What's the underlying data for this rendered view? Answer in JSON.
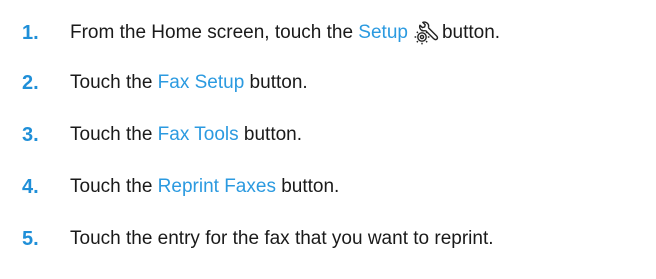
{
  "steps": [
    {
      "number": "1.",
      "before": "From the Home screen, touch the ",
      "highlight": "Setup",
      "icon": "setup-wrench-gear-icon",
      "after": "button."
    },
    {
      "number": "2.",
      "before": "Touch the ",
      "highlight": "Fax Setup",
      "after": " button."
    },
    {
      "number": "3.",
      "before": "Touch the ",
      "highlight": "Fax Tools",
      "after": " button."
    },
    {
      "number": "4.",
      "before": "Touch the ",
      "highlight": "Reprint Faxes",
      "after": " button."
    },
    {
      "number": "5.",
      "text": "Touch the entry for the fax that you want to reprint."
    }
  ],
  "colors": {
    "step_number": "#1f8fd8",
    "highlight": "#2b9ae0",
    "body_text": "#1a1a1a"
  }
}
